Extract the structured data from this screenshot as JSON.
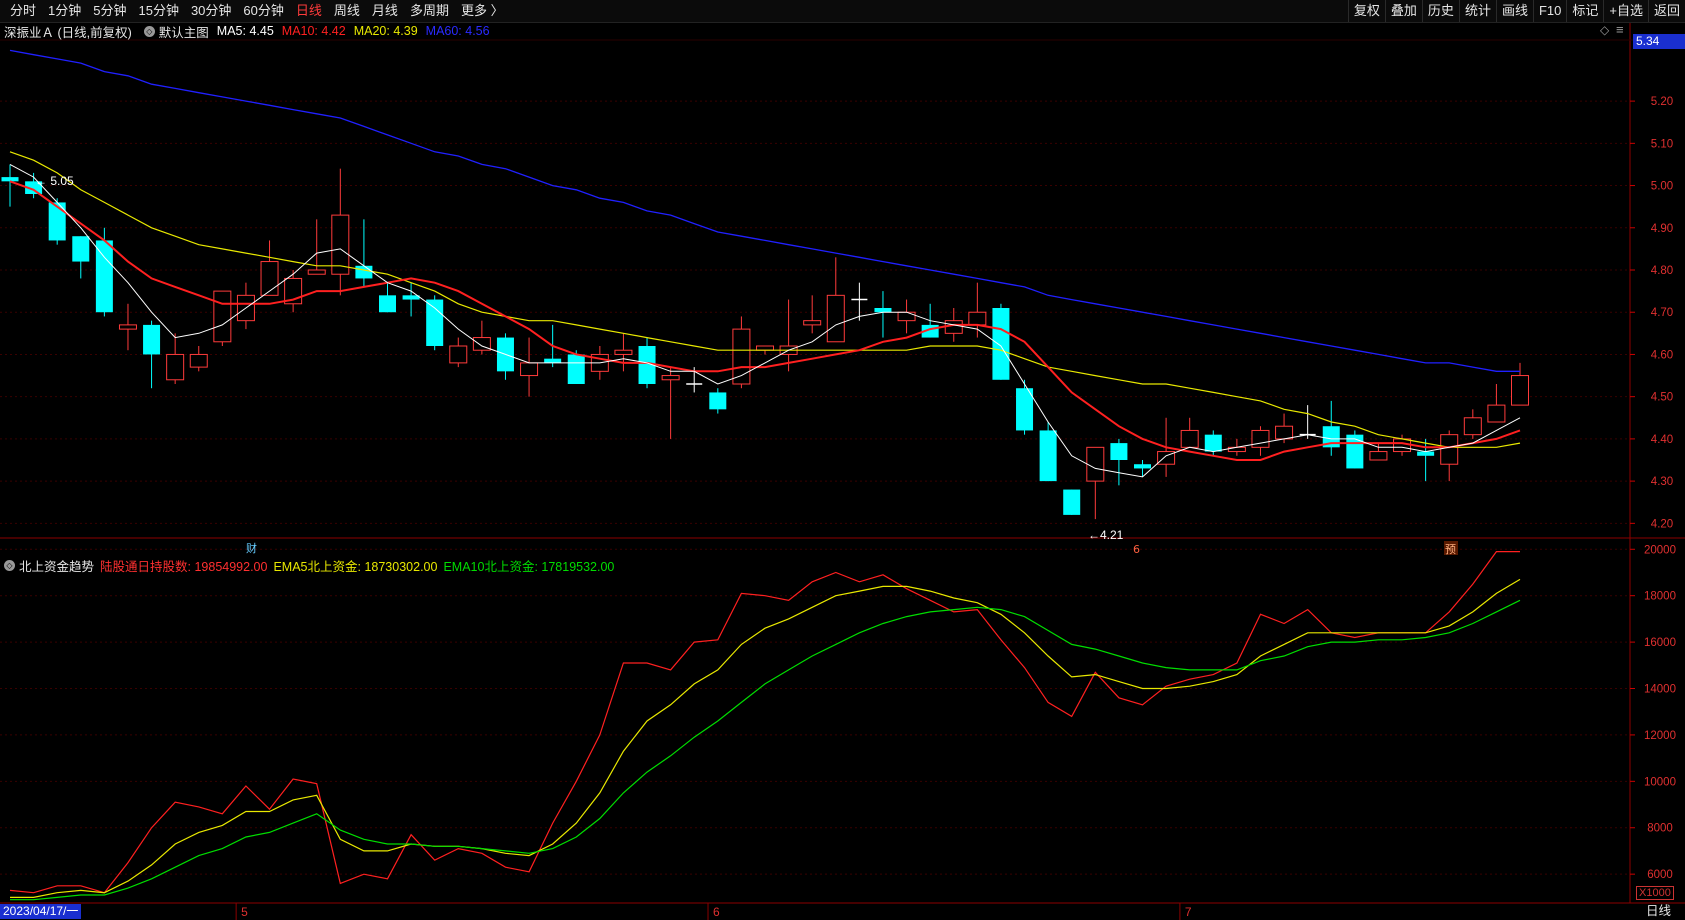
{
  "toolbar": {
    "periods": [
      "分时",
      "1分钟",
      "5分钟",
      "15分钟",
      "30分钟",
      "60分钟",
      "日线",
      "周线",
      "月线",
      "多周期",
      "更多 〉"
    ],
    "active_period": "日线",
    "tools": [
      "复权",
      "叠加",
      "历史",
      "统计",
      "画线",
      "F10",
      "标记",
      "+自选",
      "返回"
    ]
  },
  "info": {
    "stock": "深振业Ａ (日线,前复权)",
    "main_label": "默认主图",
    "ma5": "MA5: 4.45",
    "ma10": "MA10: 4.42",
    "ma20": "MA20: 4.39",
    "ma60": "MA60: 4.56",
    "diamond": "◇",
    "menu_glyph": "≡"
  },
  "indicator": {
    "name": "北上资金趋势",
    "holding": "陆股通日持股数: 19854992.00",
    "ema5": "EMA5北上资金: 18730302.00",
    "ema10": "EMA10北上资金: 17819532.00"
  },
  "markers": {
    "cai": "财",
    "yu": "预",
    "six": "6",
    "high_label": "5.05",
    "low_label": "4.21"
  },
  "current_price": "5.34",
  "x_scale_label": "X1000",
  "date_cursor": "2023/04/17/一",
  "period_label": "日线",
  "month_labels": [
    "5",
    "6",
    "7"
  ],
  "colors": {
    "up": "#ff3b3b",
    "down": "#00ffff",
    "ma5": "#ffffff",
    "ma10": "#ff2020",
    "ma20": "#e8e800",
    "ma60": "#2020ff",
    "ema10": "#00dd00"
  },
  "chart_data": [
    {
      "type": "candlestick",
      "title": "深振业Ａ (日线,前复权)",
      "y_ticks": [
        "5.20",
        "5.10",
        "5.00",
        "4.90",
        "4.80",
        "4.70",
        "4.60",
        "4.50",
        "4.40",
        "4.30",
        "4.20"
      ],
      "ylim": [
        4.17,
        5.34
      ],
      "candles": [
        [
          5.02,
          5.01,
          5.05,
          4.95
        ],
        [
          5.01,
          4.98,
          5.03,
          4.97
        ],
        [
          4.96,
          4.87,
          4.97,
          4.86
        ],
        [
          4.88,
          4.82,
          4.88,
          4.78
        ],
        [
          4.87,
          4.7,
          4.9,
          4.69
        ],
        [
          4.66,
          4.67,
          4.72,
          4.61
        ],
        [
          4.67,
          4.6,
          4.68,
          4.52
        ],
        [
          4.54,
          4.6,
          4.65,
          4.53
        ],
        [
          4.57,
          4.6,
          4.62,
          4.56
        ],
        [
          4.63,
          4.75,
          4.75,
          4.62
        ],
        [
          4.68,
          4.74,
          4.77,
          4.66
        ],
        [
          4.74,
          4.82,
          4.87,
          4.74
        ],
        [
          4.72,
          4.78,
          4.8,
          4.7
        ],
        [
          4.79,
          4.8,
          4.92,
          4.79
        ],
        [
          4.79,
          4.93,
          5.04,
          4.74
        ],
        [
          4.81,
          4.78,
          4.92,
          4.76
        ],
        [
          4.74,
          4.7,
          4.77,
          4.7
        ],
        [
          4.74,
          4.73,
          4.77,
          4.69
        ],
        [
          4.73,
          4.62,
          4.74,
          4.61
        ],
        [
          4.58,
          4.62,
          4.64,
          4.57
        ],
        [
          4.61,
          4.64,
          4.68,
          4.6
        ],
        [
          4.64,
          4.56,
          4.65,
          4.54
        ],
        [
          4.55,
          4.58,
          4.64,
          4.5
        ],
        [
          4.59,
          4.58,
          4.67,
          4.57
        ],
        [
          4.6,
          4.53,
          4.61,
          4.53
        ],
        [
          4.56,
          4.6,
          4.62,
          4.54
        ],
        [
          4.6,
          4.61,
          4.65,
          4.56
        ],
        [
          4.62,
          4.53,
          4.64,
          4.52
        ],
        [
          4.54,
          4.55,
          4.57,
          4.4
        ],
        [
          4.53,
          4.53,
          4.57,
          4.51
        ],
        [
          4.51,
          4.47,
          4.52,
          4.46
        ],
        [
          4.53,
          4.66,
          4.69,
          4.52
        ],
        [
          4.61,
          4.62,
          4.62,
          4.6
        ],
        [
          4.6,
          4.62,
          4.73,
          4.56
        ],
        [
          4.67,
          4.68,
          4.74,
          4.65
        ],
        [
          4.63,
          4.74,
          4.83,
          4.63
        ],
        [
          4.73,
          4.73,
          4.77,
          4.68
        ],
        [
          4.71,
          4.7,
          4.75,
          4.64
        ],
        [
          4.68,
          4.7,
          4.73,
          4.65
        ],
        [
          4.67,
          4.64,
          4.72,
          4.64
        ],
        [
          4.65,
          4.68,
          4.71,
          4.63
        ],
        [
          4.67,
          4.7,
          4.77,
          4.64
        ],
        [
          4.71,
          4.54,
          4.72,
          4.54
        ],
        [
          4.52,
          4.42,
          4.54,
          4.41
        ],
        [
          4.42,
          4.3,
          4.44,
          4.3
        ],
        [
          4.28,
          4.22,
          4.28,
          4.22
        ],
        [
          4.3,
          4.38,
          4.38,
          4.21
        ],
        [
          4.39,
          4.35,
          4.4,
          4.29
        ],
        [
          4.34,
          4.33,
          4.35,
          4.31
        ],
        [
          4.34,
          4.37,
          4.45,
          4.31
        ],
        [
          4.38,
          4.42,
          4.45,
          4.38
        ],
        [
          4.41,
          4.37,
          4.42,
          4.36
        ],
        [
          4.37,
          4.38,
          4.4,
          4.36
        ],
        [
          4.38,
          4.42,
          4.43,
          4.36
        ],
        [
          4.4,
          4.43,
          4.46,
          4.39
        ],
        [
          4.41,
          4.41,
          4.48,
          4.4
        ],
        [
          4.43,
          4.38,
          4.49,
          4.36
        ],
        [
          4.41,
          4.33,
          4.42,
          4.33
        ],
        [
          4.35,
          4.37,
          4.39,
          4.35
        ],
        [
          4.37,
          4.4,
          4.41,
          4.36
        ],
        [
          4.37,
          4.36,
          4.4,
          4.3
        ],
        [
          4.34,
          4.41,
          4.42,
          4.3
        ],
        [
          4.41,
          4.45,
          4.47,
          4.4
        ],
        [
          4.44,
          4.48,
          4.53,
          4.44
        ],
        [
          4.48,
          4.55,
          4.58,
          4.48
        ]
      ],
      "ma5": [
        5.05,
        5.02,
        4.96,
        4.9,
        4.83,
        4.77,
        4.7,
        4.64,
        4.65,
        4.67,
        4.71,
        4.75,
        4.79,
        4.84,
        4.85,
        4.81,
        4.77,
        4.75,
        4.71,
        4.66,
        4.62,
        4.6,
        4.58,
        4.58,
        4.58,
        4.58,
        4.59,
        4.58,
        4.56,
        4.56,
        4.53,
        4.55,
        4.58,
        4.61,
        4.63,
        4.67,
        4.69,
        4.7,
        4.7,
        4.68,
        4.67,
        4.66,
        4.62,
        4.53,
        4.44,
        4.36,
        4.33,
        4.32,
        4.31,
        4.36,
        4.38,
        4.37,
        4.38,
        4.39,
        4.4,
        4.41,
        4.4,
        4.4,
        4.38,
        4.38,
        4.37,
        4.38,
        4.39,
        4.42,
        4.45
      ],
      "ma10": [
        5.01,
        4.99,
        4.95,
        4.91,
        4.87,
        4.82,
        4.78,
        4.76,
        4.74,
        4.72,
        4.72,
        4.72,
        4.73,
        4.75,
        4.75,
        4.76,
        4.77,
        4.78,
        4.77,
        4.75,
        4.72,
        4.69,
        4.66,
        4.62,
        4.6,
        4.59,
        4.58,
        4.58,
        4.57,
        4.56,
        4.56,
        4.57,
        4.57,
        4.58,
        4.59,
        4.6,
        4.61,
        4.63,
        4.64,
        4.66,
        4.67,
        4.67,
        4.66,
        4.63,
        4.57,
        4.51,
        4.47,
        4.43,
        4.4,
        4.38,
        4.37,
        4.36,
        4.35,
        4.35,
        4.37,
        4.38,
        4.39,
        4.39,
        4.39,
        4.39,
        4.38,
        4.38,
        4.39,
        4.4,
        4.42
      ],
      "ma20": [
        5.08,
        5.06,
        5.03,
        4.99,
        4.96,
        4.93,
        4.9,
        4.88,
        4.86,
        4.85,
        4.84,
        4.83,
        4.82,
        4.81,
        4.81,
        4.8,
        4.79,
        4.77,
        4.75,
        4.72,
        4.7,
        4.69,
        4.68,
        4.68,
        4.67,
        4.66,
        4.65,
        4.64,
        4.63,
        4.62,
        4.61,
        4.61,
        4.61,
        4.61,
        4.61,
        4.61,
        4.61,
        4.61,
        4.61,
        4.62,
        4.62,
        4.62,
        4.61,
        4.59,
        4.57,
        4.56,
        4.55,
        4.54,
        4.53,
        4.53,
        4.52,
        4.51,
        4.5,
        4.49,
        4.47,
        4.46,
        4.44,
        4.43,
        4.41,
        4.4,
        4.39,
        4.38,
        4.38,
        4.38,
        4.39
      ],
      "ma60": [
        5.32,
        5.31,
        5.3,
        5.29,
        5.27,
        5.26,
        5.24,
        5.23,
        5.22,
        5.21,
        5.2,
        5.19,
        5.18,
        5.17,
        5.16,
        5.14,
        5.12,
        5.1,
        5.08,
        5.07,
        5.05,
        5.04,
        5.02,
        5.0,
        4.99,
        4.97,
        4.96,
        4.94,
        4.93,
        4.91,
        4.89,
        4.88,
        4.87,
        4.86,
        4.85,
        4.84,
        4.83,
        4.82,
        4.81,
        4.8,
        4.79,
        4.78,
        4.77,
        4.76,
        4.74,
        4.73,
        4.72,
        4.71,
        4.7,
        4.69,
        4.68,
        4.67,
        4.66,
        4.65,
        4.64,
        4.63,
        4.62,
        4.61,
        4.6,
        4.59,
        4.58,
        4.58,
        4.57,
        4.56,
        4.56
      ]
    },
    {
      "type": "line",
      "title": "北上资金趋势",
      "y_ticks": [
        "20000",
        "18000",
        "16000",
        "14000",
        "12000",
        "10000",
        "8000",
        "6000"
      ],
      "ylim": [
        4800,
        20400
      ],
      "series": [
        {
          "name": "陆股通日持股数",
          "values": [
            5300,
            5200,
            5500,
            5500,
            5200,
            6500,
            8000,
            9100,
            8900,
            8600,
            9800,
            8800,
            10100,
            9900,
            5600,
            6000,
            5800,
            7700,
            6600,
            7100,
            6900,
            6300,
            6100,
            8200,
            10000,
            12000,
            15100,
            15100,
            14800,
            16000,
            16100,
            18100,
            18000,
            17800,
            18600,
            19000,
            18600,
            18900,
            18300,
            17800,
            17300,
            17400,
            16100,
            14900,
            13400,
            12800,
            14700,
            13600,
            13300,
            14100,
            14400,
            14600,
            15100,
            17200,
            16800,
            17400,
            16400,
            16200,
            16400,
            16400,
            16400,
            17300,
            18500,
            19900,
            19900
          ]
        },
        {
          "name": "EMA5北上资金",
          "values": [
            5000,
            5000,
            5200,
            5300,
            5200,
            5700,
            6400,
            7300,
            7800,
            8100,
            8700,
            8700,
            9200,
            9400,
            7500,
            7000,
            7000,
            7300,
            7200,
            7200,
            7100,
            6900,
            6800,
            7300,
            8200,
            9500,
            11300,
            12600,
            13300,
            14200,
            14800,
            15900,
            16600,
            17000,
            17500,
            18000,
            18200,
            18400,
            18400,
            18200,
            17900,
            17700,
            17200,
            16400,
            15400,
            14500,
            14600,
            14300,
            14000,
            14000,
            14100,
            14300,
            14600,
            15400,
            15900,
            16400,
            16400,
            16400,
            16400,
            16400,
            16400,
            16700,
            17300,
            18100,
            18700
          ]
        },
        {
          "name": "EMA10北上资金",
          "values": [
            4900,
            4900,
            5000,
            5100,
            5100,
            5400,
            5800,
            6300,
            6800,
            7100,
            7600,
            7800,
            8200,
            8600,
            7900,
            7500,
            7300,
            7300,
            7200,
            7200,
            7100,
            7000,
            6900,
            7100,
            7600,
            8400,
            9500,
            10400,
            11100,
            11900,
            12600,
            13400,
            14200,
            14800,
            15400,
            15900,
            16400,
            16800,
            17100,
            17300,
            17400,
            17500,
            17400,
            17100,
            16500,
            15900,
            15700,
            15400,
            15100,
            14900,
            14800,
            14800,
            14800,
            15200,
            15400,
            15800,
            16000,
            16000,
            16100,
            16100,
            16200,
            16400,
            16800,
            17300,
            17800
          ]
        }
      ]
    }
  ]
}
